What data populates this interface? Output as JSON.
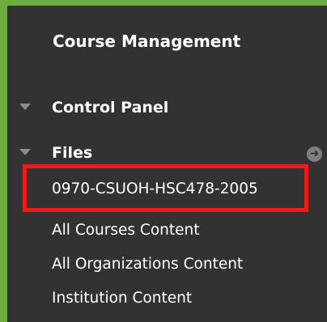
{
  "panel": {
    "heading": "Course Management",
    "sections": [
      {
        "label": "Control Panel",
        "icon": "triangle-down-icon"
      },
      {
        "label": "Files",
        "icon": "triangle-down-icon",
        "action_icon": "arrow-right-circle-icon",
        "action_glyph": "➜"
      }
    ],
    "file_links": [
      "0970-CSUOH-HSC478-2005",
      "All Courses Content",
      "All Organizations Content",
      "Institution Content"
    ]
  },
  "colors": {
    "panel_bg": "#323232",
    "border_green": "#6cad3f",
    "highlight_red": "#ee1c18"
  }
}
